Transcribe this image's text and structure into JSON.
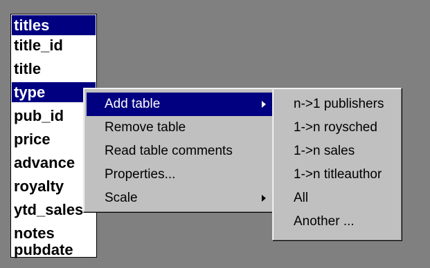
{
  "table": {
    "name": "titles",
    "columns": [
      "title_id",
      "title",
      "type",
      "pub_id",
      "price",
      "advance",
      "royalty",
      "ytd_sales",
      "notes",
      "pubdate"
    ]
  },
  "context_menu": {
    "items": [
      "Add table",
      "Remove table",
      "Read table comments",
      "Properties...",
      "Scale"
    ]
  },
  "submenu": {
    "items": [
      "n->1 publishers",
      "1->n roysched",
      "1->n sales",
      "1->n titleauthor",
      "All",
      "Another ..."
    ]
  },
  "colors": {
    "background": "#808080",
    "selection": "#000080",
    "menu_face": "#c0c0c0"
  }
}
